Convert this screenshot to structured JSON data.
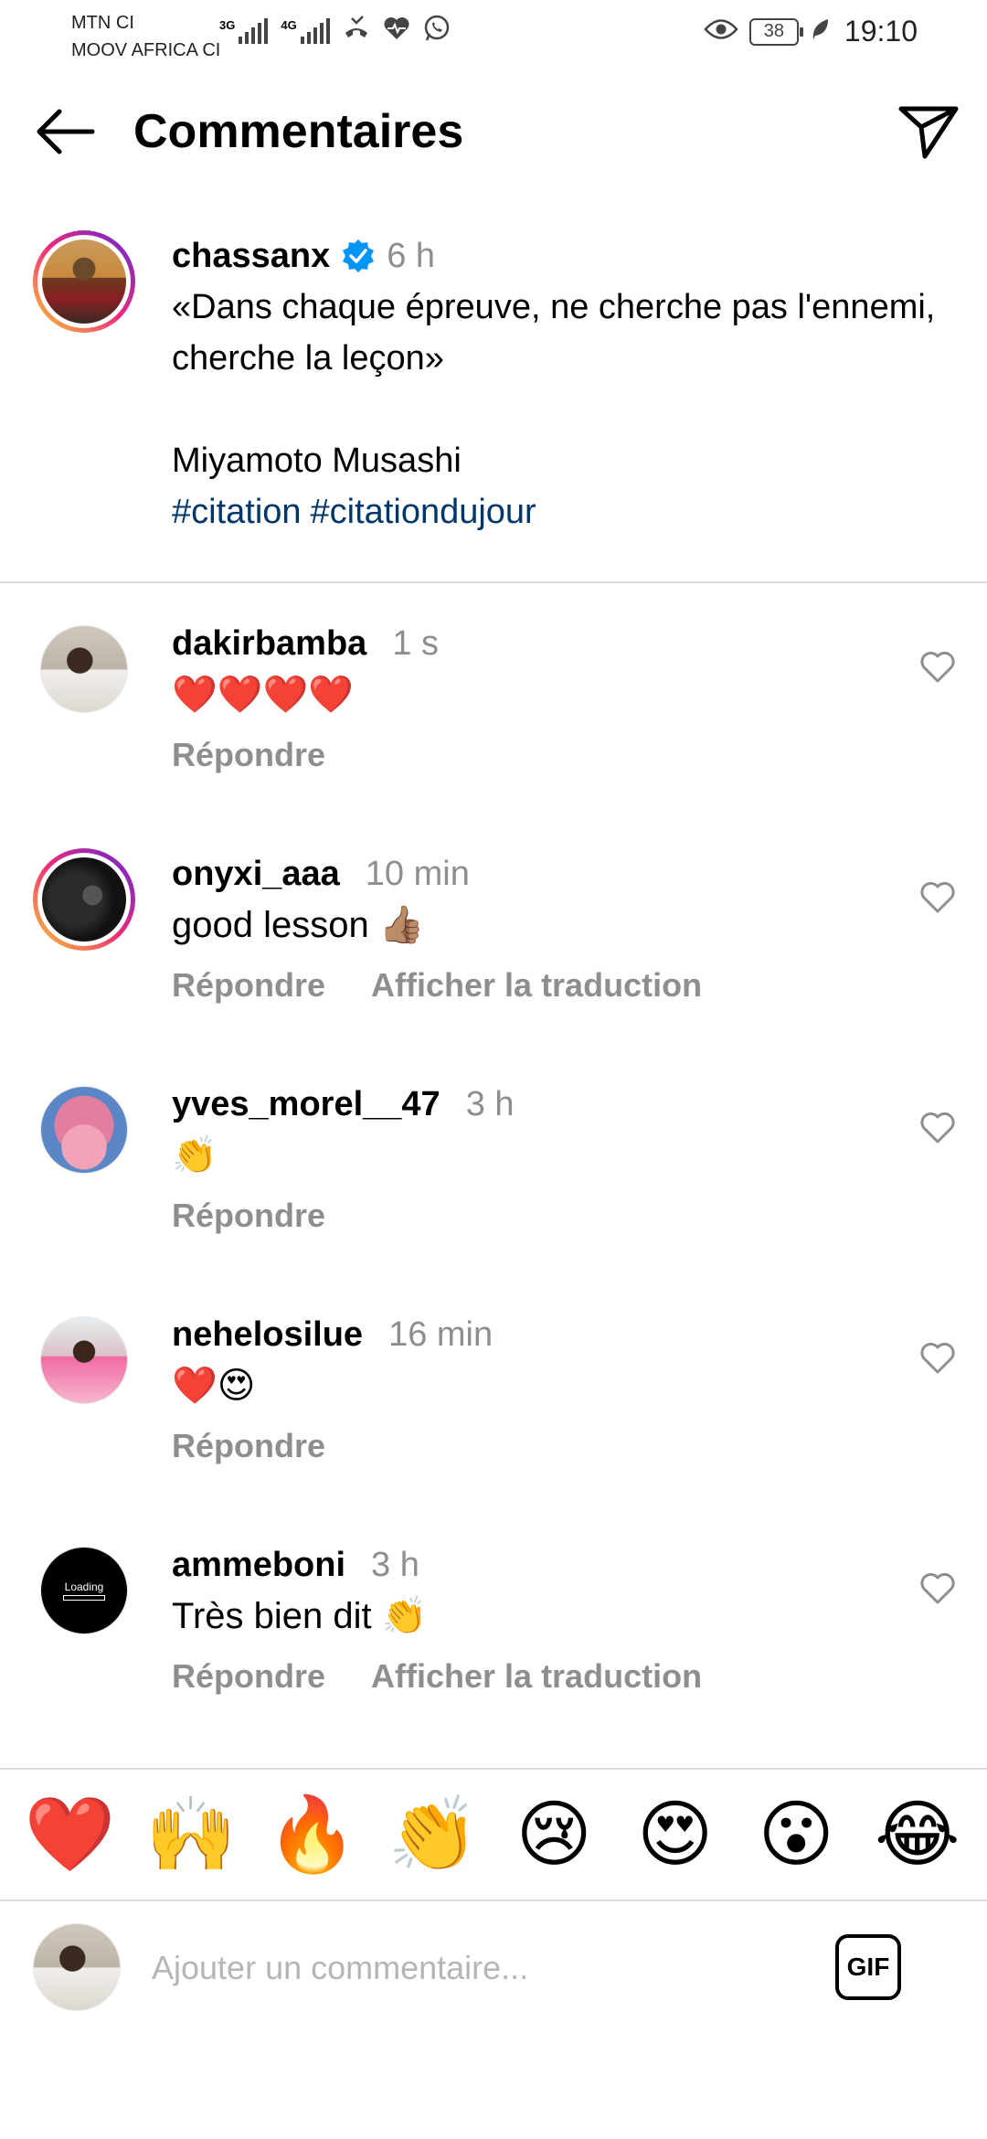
{
  "status_bar": {
    "carrier_1": "MTN CI",
    "carrier_2": "MOOV AFRICA CI",
    "network_1": "3G",
    "network_2": "4G",
    "battery": "38",
    "time": "19:10"
  },
  "header": {
    "title": "Commentaires"
  },
  "caption": {
    "username": "chassanx",
    "verified": true,
    "time": "6 h",
    "text": "«Dans chaque épreuve, ne cherche pas l'ennemi, cherche la leçon»\n\nMiyamoto Musashi",
    "hashtags": [
      "#citation",
      "#citationdujour"
    ]
  },
  "comments": [
    {
      "username": "dakirbamba",
      "time": "1 s",
      "text": "❤️❤️❤️❤️",
      "reply_label": "Répondre"
    },
    {
      "username": "onyxi_aaa",
      "time": "10 min",
      "text": "good lesson 👍🏽",
      "reply_label": "Répondre",
      "translate_label": "Afficher la traduction"
    },
    {
      "username": "yves_morel__47",
      "time": "3 h",
      "text": "👏",
      "reply_label": "Répondre"
    },
    {
      "username": "nehelosilue",
      "time": "16 min",
      "text": "❤️😍",
      "reply_label": "Répondre"
    },
    {
      "username": "ammeboni",
      "time": "3 h",
      "text": "Très bien dit 👏",
      "reply_label": "Répondre",
      "translate_label": "Afficher la traduction",
      "avatar_text": "Loading"
    }
  ],
  "emoji_bar": [
    "❤️",
    "🙌",
    "🔥",
    "👏",
    "😢",
    "😍",
    "😮",
    "😂"
  ],
  "input": {
    "placeholder": "Ajouter un commentaire...",
    "gif_label": "GIF"
  },
  "colors": {
    "hashtag": "#00376b",
    "muted": "#8e8e8e",
    "verified": "#0095f6",
    "divider": "#dbdbdb"
  }
}
